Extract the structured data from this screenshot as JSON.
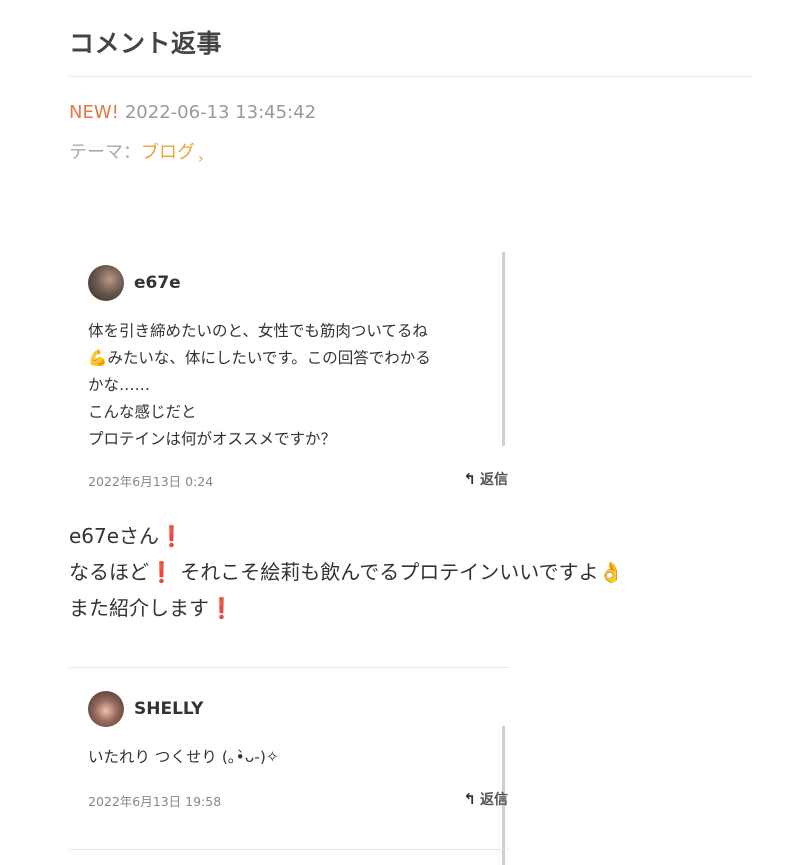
{
  "header": {
    "title": "コメント返事"
  },
  "meta": {
    "new_label": "NEW!",
    "datetime": "2022-06-13 13:45:42",
    "theme_prefix": "テーマ：",
    "theme_link": "ブログ",
    "theme_chevron": "›"
  },
  "comments": [
    {
      "name": "e67e",
      "body": [
        "体を引き締めたいのと、女性でも筋肉ついてるね",
        "💪",
        "みたいな、体にしたいです。この回答でわかる",
        "かな……",
        "こんな感じだと",
        "プロテインは何がオススメですか？"
      ],
      "date": "2022年6月13日 0:24",
      "reply_label": "返信"
    },
    {
      "name": "SHELLY",
      "body": [
        "いたれり つくせり (｡•̀ᴗ-)✧"
      ],
      "date": "2022年6月13日 19:58",
      "reply_label": "返信"
    }
  ],
  "response": {
    "line1": "e67eさん",
    "line2a": "なるほど",
    "line2b": "それこそ絵莉も飲んでるプロテインいいですよ",
    "line3": "また紹介します",
    "exclaim": "❗",
    "ok_emoji": "👌"
  },
  "icons": {
    "reply": "↰"
  }
}
